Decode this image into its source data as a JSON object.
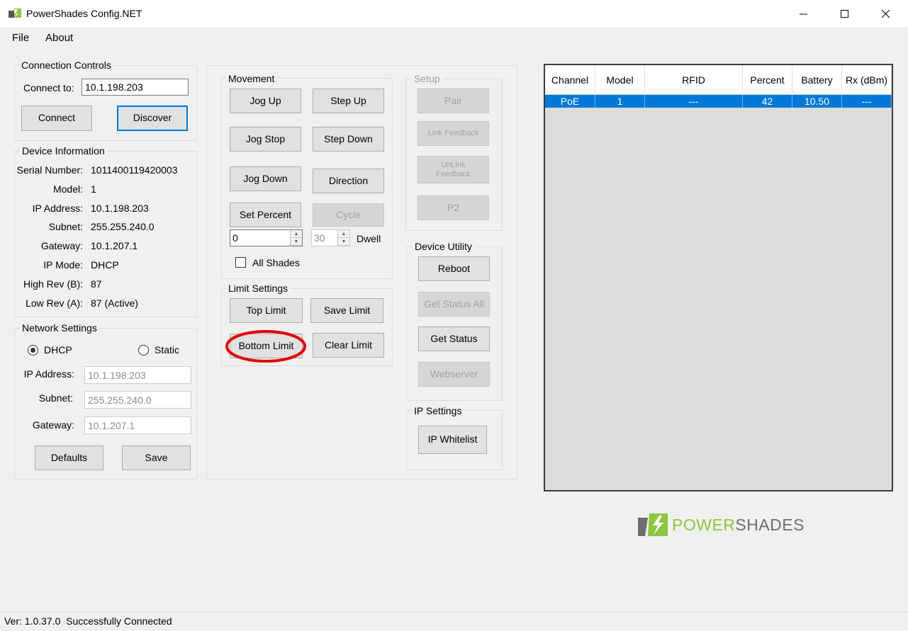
{
  "window": {
    "title": "PowerShades Config.NET"
  },
  "menu": {
    "file": "File",
    "about": "About"
  },
  "connection": {
    "title": "Connection Controls",
    "connect_to_label": "Connect to:",
    "connect_to_value": "10.1.198.203",
    "connect_button": "Connect",
    "discover_button": "Discover"
  },
  "device_info": {
    "title": "Device Information",
    "rows": [
      {
        "label": "Serial Number:",
        "value": "1011400119420003"
      },
      {
        "label": "Model:",
        "value": "1"
      },
      {
        "label": "IP Address:",
        "value": "10.1.198.203"
      },
      {
        "label": "Subnet:",
        "value": "255.255.240.0"
      },
      {
        "label": "Gateway:",
        "value": "10.1.207.1"
      },
      {
        "label": "IP Mode:",
        "value": "DHCP"
      },
      {
        "label": "High Rev (B):",
        "value": "87"
      },
      {
        "label": "Low Rev (A):",
        "value": "87 (Active)"
      }
    ]
  },
  "network": {
    "title": "Network Settings",
    "dhcp_label": "DHCP",
    "static_label": "Static",
    "selected_mode": "DHCP",
    "ip_label": "IP Address:",
    "ip_value": "10.1.198.203",
    "subnet_label": "Subnet:",
    "subnet_value": "255.255.240.0",
    "gateway_label": "Gateway:",
    "gateway_value": "10.1.207.1",
    "defaults_button": "Defaults",
    "save_button": "Save"
  },
  "movement": {
    "title": "Movement",
    "jog_up": "Jog Up",
    "step_up": "Step Up",
    "jog_stop": "Jog Stop",
    "step_down": "Step Down",
    "jog_down": "Jog Down",
    "direction": "Direction",
    "set_percent": "Set Percent",
    "cycle": "Cycle",
    "percent_value": "0",
    "dwell_value": "30",
    "dwell_label": "Dwell",
    "all_shades_label": "All Shades",
    "all_shades_checked": false
  },
  "limits": {
    "title": "Limit Settings",
    "top_limit": "Top Limit",
    "save_limit": "Save Limit",
    "bottom_limit": "Bottom Limit",
    "clear_limit": "Clear Limit",
    "highlight_color": "#e00000"
  },
  "setup": {
    "title": "Setup",
    "pair": "Pair",
    "link_feedback": "Link Feedback",
    "unlink_feedback_1": "UnLink",
    "unlink_feedback_2": "Feedback",
    "p2": "P2"
  },
  "utility": {
    "title": "Device Utility",
    "reboot": "Reboot",
    "get_status_all": "Get Status All",
    "get_status": "Get Status",
    "webserver": "Webserver"
  },
  "ip_settings": {
    "title": "IP Settings",
    "ip_whitelist": "IP Whitelist"
  },
  "grid": {
    "columns": [
      "Channel",
      "Model",
      "RFID",
      "Percent",
      "Battery",
      "Rx (dBm)"
    ],
    "rows": [
      [
        "PoE",
        "1",
        "---",
        "42",
        "10.50",
        "---"
      ]
    ],
    "selected_color": "#0078d7"
  },
  "logo": {
    "text_power": "POWER",
    "text_shades": "SHADES",
    "green": "#8dc63f",
    "grey": "#6d6e70"
  },
  "status": {
    "text": "Ver: 1.0.37.0  Successfully Connected"
  }
}
